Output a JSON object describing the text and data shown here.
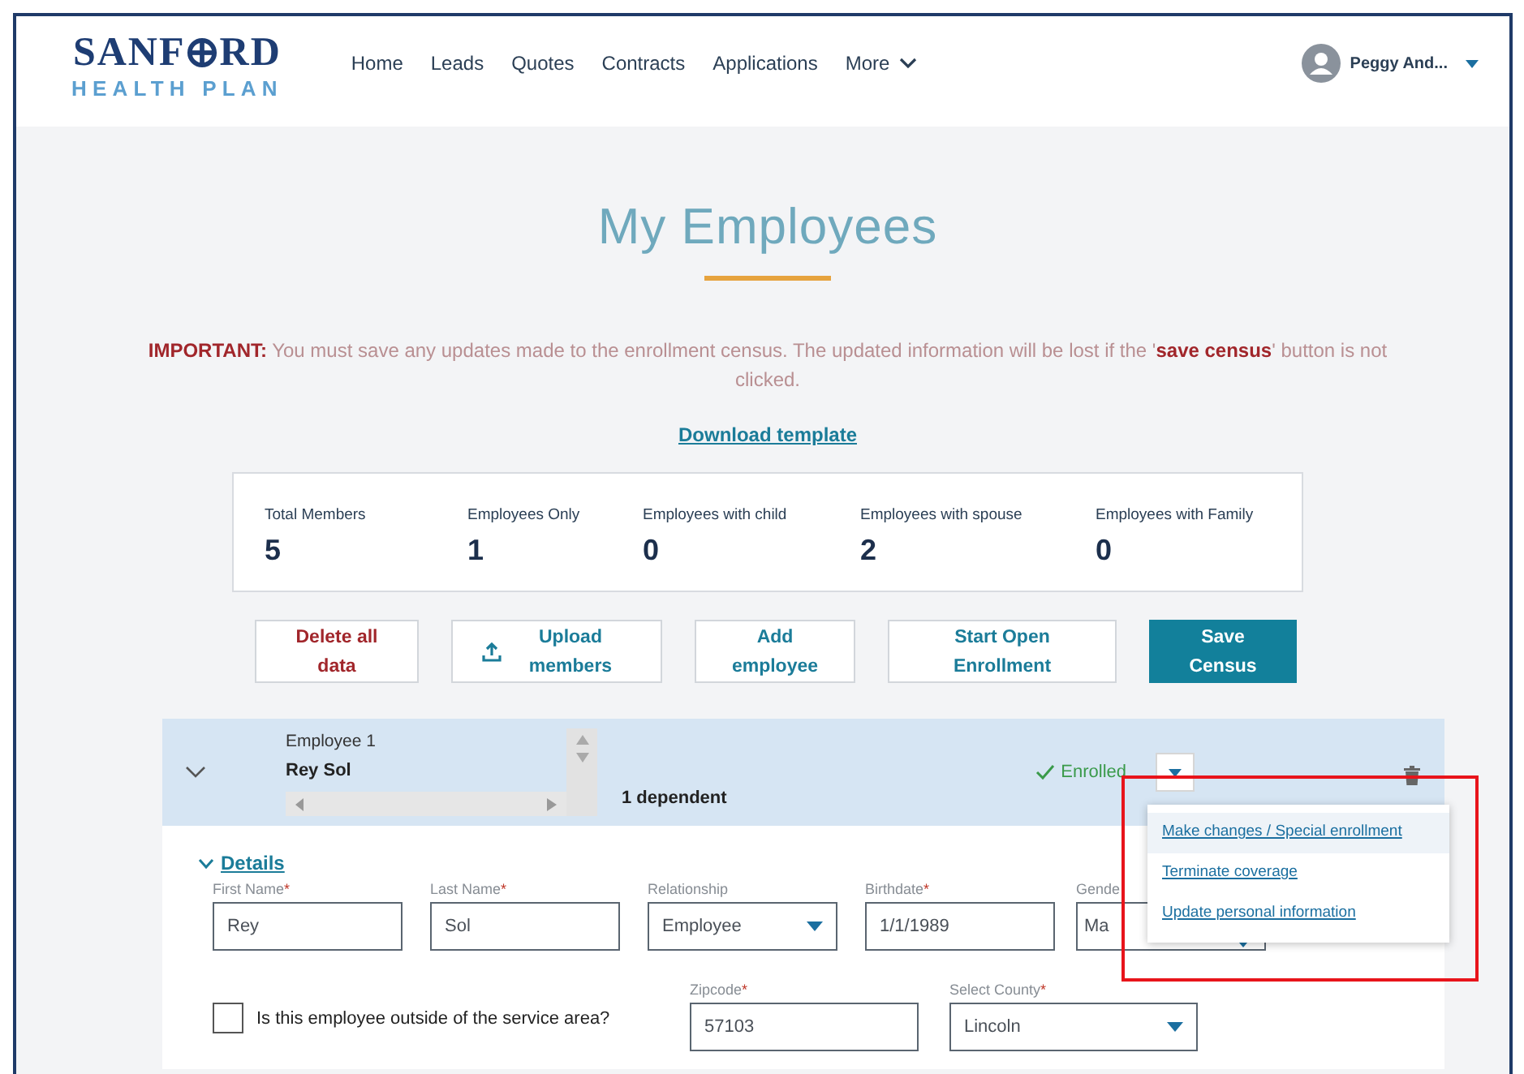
{
  "header": {
    "logo_top": "SANF",
    "logo_top_end": "RD",
    "logo_bottom": "HEALTH PLAN",
    "nav": [
      {
        "label": "Home",
        "dropdown": false
      },
      {
        "label": "Leads",
        "dropdown": false
      },
      {
        "label": "Quotes",
        "dropdown": false
      },
      {
        "label": "Contracts",
        "dropdown": false
      },
      {
        "label": "Applications",
        "dropdown": false
      },
      {
        "label": "More",
        "dropdown": true
      }
    ],
    "user": "Peggy And..."
  },
  "title": "My Employees",
  "notice": "**IMPORTANT:** You must save any updates made to the enrollment census. The updated information will be lost if the '**save census**' button is not clicked.",
  "download_link": "Download template",
  "stats": [
    {
      "label": "Total Members",
      "value": "5"
    },
    {
      "label": "Employees Only",
      "value": "1"
    },
    {
      "label": "Employees with child",
      "value": "0"
    },
    {
      "label": "Employees with spouse",
      "value": "2"
    },
    {
      "label": "Employees with Family",
      "value": "0"
    }
  ],
  "actions": [
    {
      "label": "Delete all data",
      "kind": "danger"
    },
    {
      "label": "Upload members",
      "kind": "upload"
    },
    {
      "label": "Add employee",
      "kind": "default"
    },
    {
      "label": "Start Open Enrollment",
      "kind": "default"
    },
    {
      "label": "Save Census",
      "kind": "primary"
    }
  ],
  "employee": {
    "expanded": true,
    "caption": "Employee 1",
    "name": "Rey Sol",
    "dependents": "1 dependent",
    "status": "Enrolled",
    "enrolled": true,
    "details_link": "Details",
    "fields": [
      {
        "label": "First Name",
        "mark": "*",
        "value": "Rey",
        "kind": "text"
      },
      {
        "label": "Last Name",
        "mark": "*",
        "value": "Sol",
        "kind": "text"
      },
      {
        "label": "Relationship",
        "value": "Employee",
        "kind": "select"
      },
      {
        "label": "Birthdate",
        "mark": "*",
        "value": "1/1/1989",
        "kind": "text"
      },
      {
        "label": "Gende",
        "value": "Ma",
        "kind": "select"
      }
    ],
    "outside_area": {
      "label": "Is this employee outside of the service area?",
      "checked": false
    },
    "zipcode": {
      "label": "Zipcode",
      "mark": "*",
      "value": "57103"
    },
    "county": {
      "label": "Select County",
      "mark": "*",
      "value": "Lincoln"
    }
  },
  "menu": [
    {
      "label": "Make changes / Special enrollment",
      "selected": true
    },
    {
      "label": "Terminate coverage",
      "selected": false
    },
    {
      "label": "Update personal information",
      "selected": false
    }
  ]
}
